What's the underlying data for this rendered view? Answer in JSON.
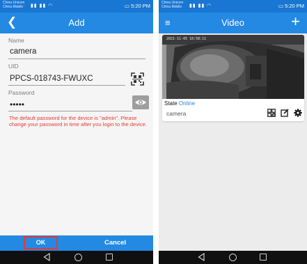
{
  "left": {
    "statusbar": {
      "carrier_1": "China Unicom",
      "carrier_2": "China Mobile",
      "time": "5:20 PM"
    },
    "toolbar": {
      "title": "Add"
    },
    "form": {
      "name_label": "Name",
      "name_value": "camera",
      "uid_label": "UID",
      "uid_value": "PPCS-018743-FWUXC",
      "password_label": "Password",
      "password_value": "•••••",
      "warning": "The default password for the device is \"admin\". Please change your password in time after you login to the device."
    },
    "actions": {
      "ok_label": "OK",
      "cancel_label": "Cancel"
    }
  },
  "right": {
    "statusbar": {
      "carrier_1": "China Unicom",
      "carrier_2": "China Mobile",
      "time": "5:20 PM"
    },
    "toolbar": {
      "title": "Video"
    },
    "camera": {
      "timestamp": "2021-11-05 10:58:11",
      "state_label": "State",
      "state_value": "Online",
      "name": "camera"
    }
  },
  "colors": {
    "toolbar": "#2389e3",
    "statusbar": "#1976d2",
    "warning": "#e53935",
    "online": "#1e88e5",
    "navbar": "#101010"
  },
  "icons": [
    "back-arrow-icon",
    "menu-icon",
    "add-icon",
    "qr-scan-icon",
    "eye-icon",
    "qr-code-icon",
    "edit-icon",
    "settings-gear-icon"
  ]
}
